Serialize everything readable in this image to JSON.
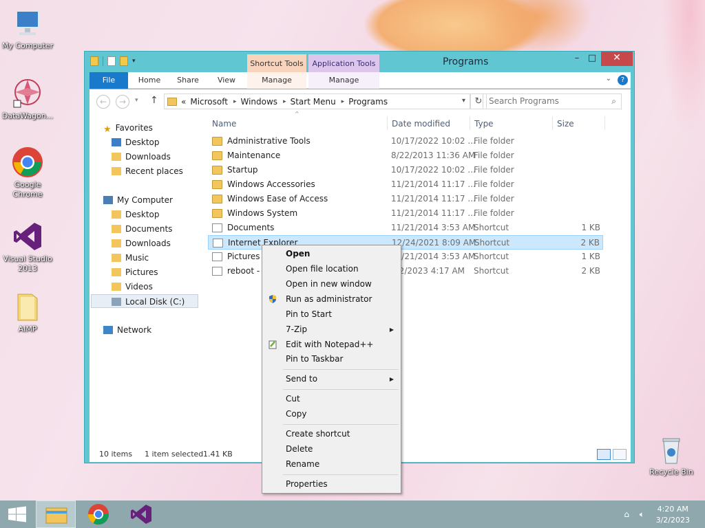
{
  "desktop": {
    "icons": [
      {
        "label": "My Computer"
      },
      {
        "label": "DataWagon..."
      },
      {
        "label": "Google Chrome"
      },
      {
        "label": "Visual Studio 2013"
      },
      {
        "label": "AIMP"
      },
      {
        "label": "Recycle Bin"
      }
    ]
  },
  "window": {
    "title": "Programs",
    "context_tabs": {
      "shortcut": "Shortcut Tools",
      "application": "Application Tools"
    },
    "controls": {
      "minimize": "–",
      "maximize": "□",
      "close": "✕"
    },
    "ribbon_tabs": [
      "File",
      "Home",
      "Share",
      "View",
      "Manage",
      "Manage"
    ],
    "help": "?",
    "address": {
      "prefix": "«",
      "segments": [
        "Microsoft",
        "Windows",
        "Start Menu",
        "Programs"
      ]
    },
    "search": {
      "placeholder": "Search Programs"
    },
    "nav": {
      "favorites": {
        "label": "Favorites",
        "items": [
          "Desktop",
          "Downloads",
          "Recent places"
        ]
      },
      "computer": {
        "label": "My Computer",
        "items": [
          "Desktop",
          "Documents",
          "Downloads",
          "Music",
          "Pictures",
          "Videos",
          "Local Disk (C:)"
        ]
      },
      "network": "Network"
    },
    "columns": {
      "name": "Name",
      "date": "Date modified",
      "type": "Type",
      "size": "Size"
    },
    "files": [
      {
        "name": "Administrative Tools",
        "date": "10/17/2022 10:02 ...",
        "type": "File folder",
        "size": "",
        "kind": "folder"
      },
      {
        "name": "Maintenance",
        "date": "8/22/2013 11:36 AM",
        "type": "File folder",
        "size": "",
        "kind": "folder"
      },
      {
        "name": "Startup",
        "date": "10/17/2022 10:02 ...",
        "type": "File folder",
        "size": "",
        "kind": "folder"
      },
      {
        "name": "Windows Accessories",
        "date": "11/21/2014 11:17 ...",
        "type": "File folder",
        "size": "",
        "kind": "folder"
      },
      {
        "name": "Windows Ease of Access",
        "date": "11/21/2014 11:17 ...",
        "type": "File folder",
        "size": "",
        "kind": "folder"
      },
      {
        "name": "Windows System",
        "date": "11/21/2014 11:17 ...",
        "type": "File folder",
        "size": "",
        "kind": "folder"
      },
      {
        "name": "Documents",
        "date": "11/21/2014 3:53 AM",
        "type": "Shortcut",
        "size": "1 KB",
        "kind": "shortcut"
      },
      {
        "name": "Internet Explorer",
        "date": "12/24/2021 8:09 AM",
        "type": "Shortcut",
        "size": "2 KB",
        "kind": "shortcut"
      },
      {
        "name": "Pictures",
        "date": "11/21/2014 3:53 AM",
        "type": "Shortcut",
        "size": "1 KB",
        "kind": "shortcut"
      },
      {
        "name": "reboot - S",
        "date": "3/2/2023 4:17 AM",
        "type": "Shortcut",
        "size": "2 KB",
        "kind": "shortcut"
      }
    ],
    "status": {
      "count": "10 items",
      "selected": "1 item selected",
      "size": "1.41 KB"
    }
  },
  "context_menu": {
    "groups": [
      [
        "Open",
        "Open file location",
        "Open in new window",
        "Run as administrator",
        "Pin to Start",
        "7-Zip",
        "Edit with Notepad++",
        "Pin to Taskbar"
      ],
      [
        "Send to"
      ],
      [
        "Cut",
        "Copy"
      ],
      [
        "Create shortcut",
        "Delete",
        "Rename"
      ],
      [
        "Properties"
      ]
    ]
  },
  "taskbar": {
    "time": "4:20 AM",
    "date": "3/2/2023"
  },
  "colors": {
    "window_frame": "#5fc6d2",
    "file_tab": "#1979ca",
    "selection": "#cce8ff",
    "close_button": "#c7484a",
    "taskbar": "#8ea8ad"
  }
}
